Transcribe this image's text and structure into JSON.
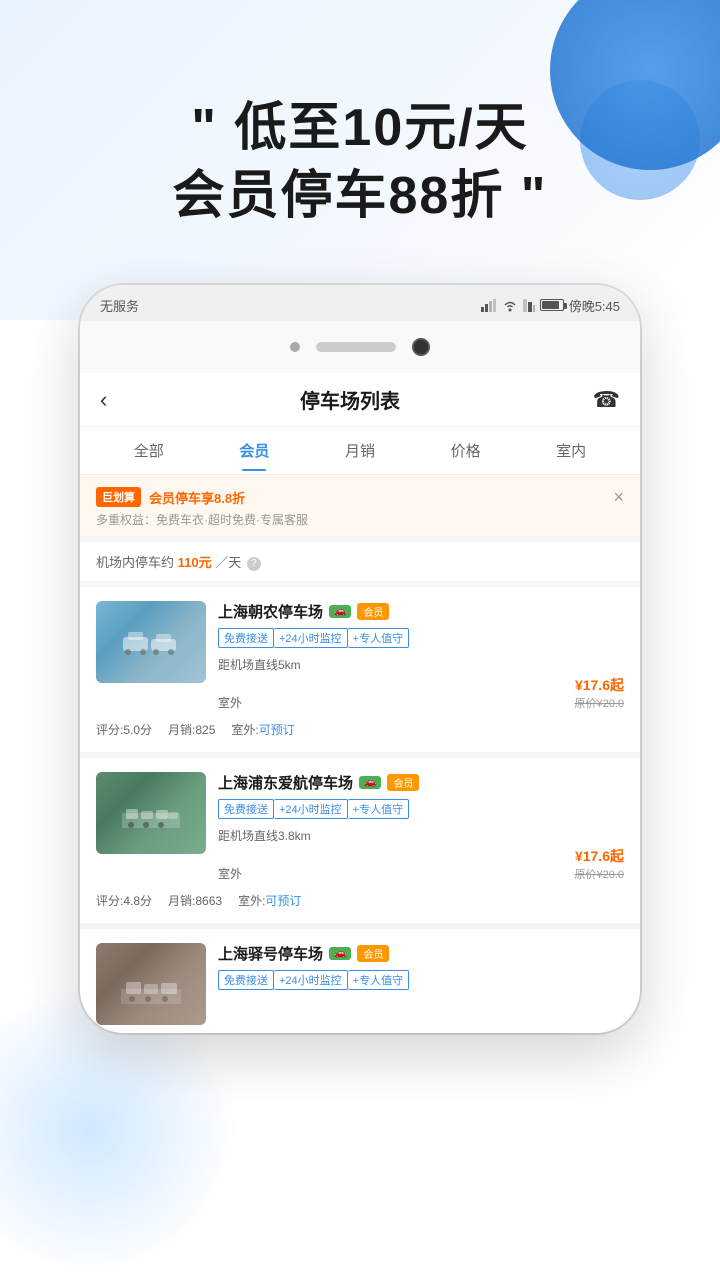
{
  "hero": {
    "line1": "\" 低至10元/天",
    "line2": "会员停车88折 \""
  },
  "status_bar": {
    "signal": "无服务",
    "wifi": "WiFi",
    "battery": "80%",
    "time": "傍晚5:45"
  },
  "nav": {
    "back_icon": "‹",
    "title": "停车场列表",
    "phone_icon": "☎"
  },
  "tabs": [
    {
      "label": "全部",
      "active": false
    },
    {
      "label": "会员",
      "active": true
    },
    {
      "label": "月销",
      "active": false
    },
    {
      "label": "价格",
      "active": false
    },
    {
      "label": "室内",
      "active": false
    }
  ],
  "promo": {
    "tag": "巨划算",
    "text": "会员停车享8.8折",
    "sub": "多重权益：免费车衣·超时免费·专属客服",
    "close_icon": "×"
  },
  "airport_info": {
    "text": "机场内停车约",
    "price": "110元",
    "unit": "／天",
    "help": "?"
  },
  "parking_lots": [
    {
      "name": "上海朝农停车场",
      "badge_green": "🚗",
      "badge_member": "会员",
      "features": [
        "免费接送",
        "+24小时监控",
        "+专人值守"
      ],
      "distance": "距机场直线5km",
      "type": "室外",
      "price_current": "¥17.6起",
      "price_original": "原价¥20.0",
      "rating": "评分:5.0分",
      "monthly_sales": "月销:825",
      "outdoor_status": "室外:可预订",
      "outdoor_bookable": true
    },
    {
      "name": "上海浦东爱航停车场",
      "badge_green": "🚗",
      "badge_member": "会员",
      "features": [
        "免费接送",
        "+24小时监控",
        "+专人值守"
      ],
      "distance": "距机场直线3.8km",
      "type": "室外",
      "price_current": "¥17.6起",
      "price_original": "原价¥20.0",
      "rating": "评分:4.8分",
      "monthly_sales": "月销:8663",
      "outdoor_status": "室外:可预订",
      "outdoor_bookable": true
    },
    {
      "name": "上海驿号停车场",
      "badge_green": "🚗",
      "badge_member": "会员",
      "features": [
        "免费接送",
        "+24小时监控",
        "+专人值守"
      ],
      "distance": "",
      "type": "",
      "price_current": "",
      "price_original": "",
      "rating": "",
      "monthly_sales": "",
      "outdoor_status": "",
      "outdoor_bookable": false
    }
  ],
  "colors": {
    "brand_blue": "#3a8ee6",
    "orange": "#ff6600",
    "member_gold": "#ff9800",
    "green": "#4caf50"
  }
}
